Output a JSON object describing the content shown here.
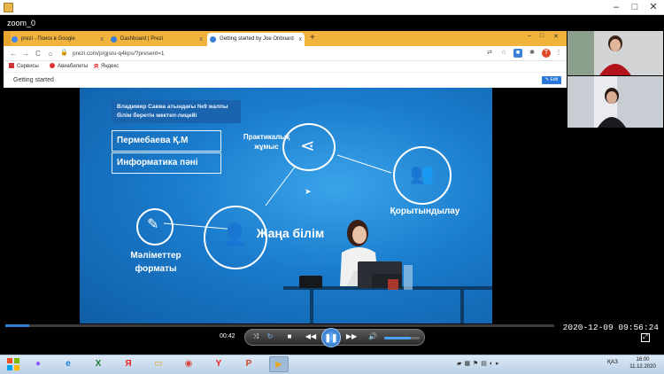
{
  "window": {
    "title": "",
    "icon": "media-player-icon",
    "min": "–",
    "max": "□",
    "close": "✕"
  },
  "zoom_bar": {
    "title": "zoom_0"
  },
  "browser": {
    "tabs": [
      {
        "label": "prezi - Поиск в Google",
        "close": "x"
      },
      {
        "label": "Dashboard | Prezi",
        "close": "x"
      },
      {
        "label": "Getting started by Joe Onboard",
        "close": "x"
      }
    ],
    "new_tab": "+",
    "window_controls": {
      "min": "–",
      "max": "□",
      "close": "✕"
    },
    "nav": {
      "back": "←",
      "forward": "→",
      "reload": "C",
      "home": "⌂"
    },
    "url": "prezi.com/p/gjsru-q4kps/?present=1",
    "bookmarks": [
      {
        "label": "Сервисы",
        "icon": "apps-icon"
      },
      {
        "label": "Авиабилеты",
        "icon": "plane-icon"
      },
      {
        "label": "Яндекс",
        "icon": "yandex-icon"
      }
    ],
    "page_title": "Getting started",
    "edit_label": "Edit"
  },
  "slide": {
    "school": "Владимир Савва атындағы №9 жалпы білім беретін мектеп-лицейі",
    "teacher": "Пермебаева Қ.М",
    "subject": "Информатика пәні",
    "center": "Жаңа білім",
    "nodes": {
      "practice": "Практикалық жұмыс",
      "summary": "Қорытындылау",
      "formats": "Мәліметтер форматы"
    }
  },
  "player": {
    "time": "00:42",
    "timestamp": "2020-12-09 09:56:24",
    "progress": 0.044,
    "volume": 0.75,
    "buttons": {
      "shuffle": "⤨",
      "repeat": "↻",
      "stop": "■",
      "prev": "◀◀",
      "play": "❚❚",
      "next": "▶▶",
      "volume": "🔊",
      "fullscreen": "⤢"
    }
  },
  "taskbar": {
    "apps": [
      {
        "name": "alice-icon",
        "glyph": "●"
      },
      {
        "name": "ie-icon",
        "glyph": "e"
      },
      {
        "name": "excel-icon",
        "glyph": "X"
      },
      {
        "name": "yandex-browser-icon",
        "glyph": "Я"
      },
      {
        "name": "file-explorer-icon",
        "glyph": "▭"
      },
      {
        "name": "chrome-icon",
        "glyph": "◉"
      },
      {
        "name": "yandex-icon",
        "glyph": "Y"
      },
      {
        "name": "powerpoint-icon",
        "glyph": "P"
      },
      {
        "name": "media-player-icon",
        "glyph": "▶"
      }
    ],
    "lang": "ҚАЗ",
    "time": "16:00",
    "date": "11.12.2020"
  }
}
